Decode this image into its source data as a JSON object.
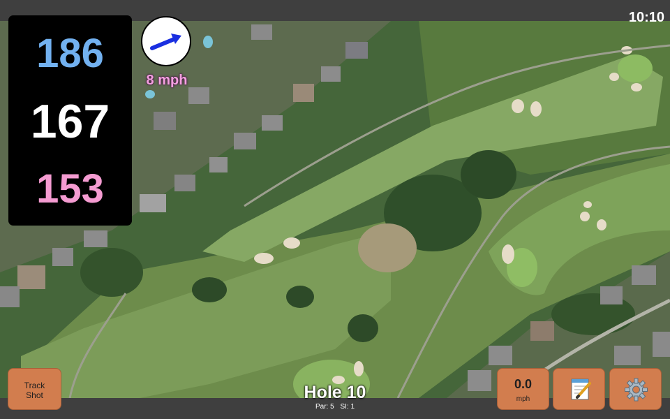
{
  "status": {
    "time": "10:10"
  },
  "yardage": {
    "back": "186",
    "middle": "167",
    "front": "153"
  },
  "wind": {
    "speed_label": "8 mph",
    "direction_icon": "arrow-icon"
  },
  "hole": {
    "title": "Hole 10",
    "par": "Par: 5",
    "si": "SI: 1"
  },
  "buttons": {
    "track_shot": {
      "line1": "Track",
      "line2": "Shot"
    },
    "speed": {
      "value": "0.0",
      "unit": "mph"
    },
    "notes_icon": "notepad-icon",
    "settings_icon": "gear-icon"
  },
  "colors": {
    "back_yardage": "#72b1f0",
    "middle_yardage": "#ffffff",
    "front_yardage": "#f49bd1",
    "button": "#d27d4e",
    "wind_arrow": "#1a2fe0"
  }
}
